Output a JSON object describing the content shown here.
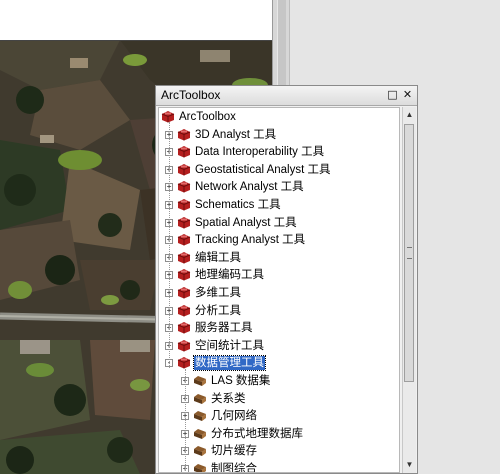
{
  "window": {
    "title": "ArcToolbox",
    "minimize_glyph": "□",
    "close_glyph": "✕"
  },
  "tree": {
    "root": {
      "label": "ArcToolbox",
      "icon": "toolbox-icon"
    },
    "items": [
      {
        "label": "3D Analyst 工具",
        "expanded": false
      },
      {
        "label": "Data Interoperability 工具",
        "expanded": false
      },
      {
        "label": "Geostatistical Analyst 工具",
        "expanded": false
      },
      {
        "label": "Network Analyst 工具",
        "expanded": false
      },
      {
        "label": "Schematics 工具",
        "expanded": false
      },
      {
        "label": "Spatial Analyst 工具",
        "expanded": false
      },
      {
        "label": "Tracking Analyst 工具",
        "expanded": false
      },
      {
        "label": "编辑工具",
        "expanded": false
      },
      {
        "label": "地理编码工具",
        "expanded": false
      },
      {
        "label": "多维工具",
        "expanded": false
      },
      {
        "label": "分析工具",
        "expanded": false
      },
      {
        "label": "服务器工具",
        "expanded": false
      },
      {
        "label": "空间统计工具",
        "expanded": false
      },
      {
        "label": "数据管理工具",
        "expanded": true,
        "selected": true
      }
    ],
    "children": [
      {
        "label": "LAS 数据集"
      },
      {
        "label": "关系类"
      },
      {
        "label": "几何网络"
      },
      {
        "label": "分布式地理数据库"
      },
      {
        "label": "切片缓存"
      },
      {
        "label": "制图综合"
      }
    ]
  },
  "scrollbar": {
    "up": "▲",
    "down": "▼"
  },
  "colors": {
    "selection": "#3169c6",
    "toolbox_red": "#b41e1e"
  }
}
